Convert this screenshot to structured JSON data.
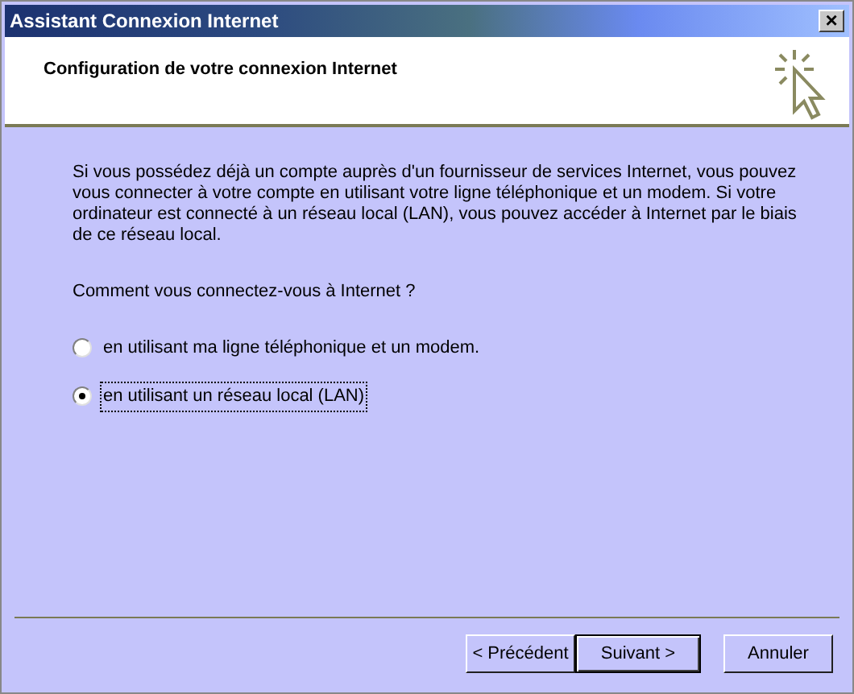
{
  "window": {
    "title": "Assistant Connexion Internet",
    "close": "×"
  },
  "header": {
    "title": "Configuration de votre connexion Internet"
  },
  "intro": "Si vous possédez déjà un compte auprès d'un fournisseur de services Internet, vous pouvez vous connecter à votre compte en utilisant votre ligne téléphonique et un modem. Si votre ordinateur est connecté à un réseau local (LAN), vous pouvez accéder à Internet par le biais de ce réseau local.",
  "question": "Comment vous connectez-vous à Internet ?",
  "options": [
    {
      "label": "en utilisant ma ligne téléphonique et un modem.",
      "selected": false
    },
    {
      "label": "en utilisant un réseau local (LAN)",
      "selected": true
    }
  ],
  "buttons": [
    {
      "label": "< Précédent",
      "default": false
    },
    {
      "label": "Suivant >",
      "default": true
    },
    {
      "label": "Annuler",
      "default": false
    }
  ]
}
